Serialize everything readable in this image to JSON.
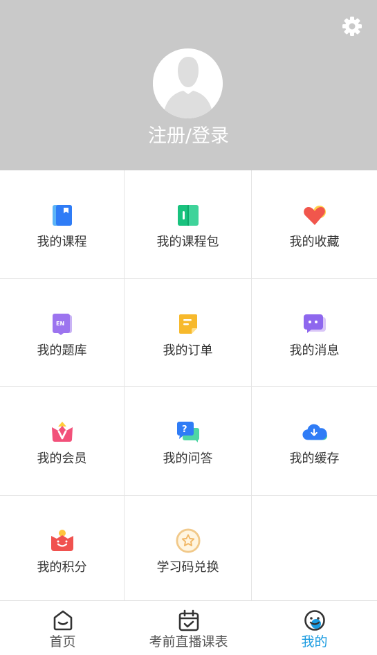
{
  "header": {
    "login_label": "注册/登录"
  },
  "menu": [
    {
      "label": "我的课程",
      "icon": "course-book-icon"
    },
    {
      "label": "我的课程包",
      "icon": "course-package-icon"
    },
    {
      "label": "我的收藏",
      "icon": "heart-tag-icon"
    },
    {
      "label": "我的题库",
      "icon": "question-bank-icon"
    },
    {
      "label": "我的订单",
      "icon": "order-note-icon"
    },
    {
      "label": "我的消息",
      "icon": "message-bubble-icon"
    },
    {
      "label": "我的会员",
      "icon": "vip-crown-icon"
    },
    {
      "label": "我的问答",
      "icon": "qa-bubble-icon"
    },
    {
      "label": "我的缓存",
      "icon": "cloud-download-icon"
    },
    {
      "label": "我的积分",
      "icon": "points-bag-icon"
    },
    {
      "label": "学习码兑换",
      "icon": "star-coin-icon"
    }
  ],
  "tabbar": {
    "items": [
      {
        "label": "首页",
        "icon": "home-icon"
      },
      {
        "label": "考前直播课表",
        "icon": "calendar-check-icon"
      },
      {
        "label": "我的",
        "icon": "smiley-profile-icon"
      }
    ],
    "active_index": 2,
    "active_color": "#1a9be0"
  },
  "colors": {
    "header_bg": "#c9c9c9",
    "divider": "#e4e4e4"
  }
}
